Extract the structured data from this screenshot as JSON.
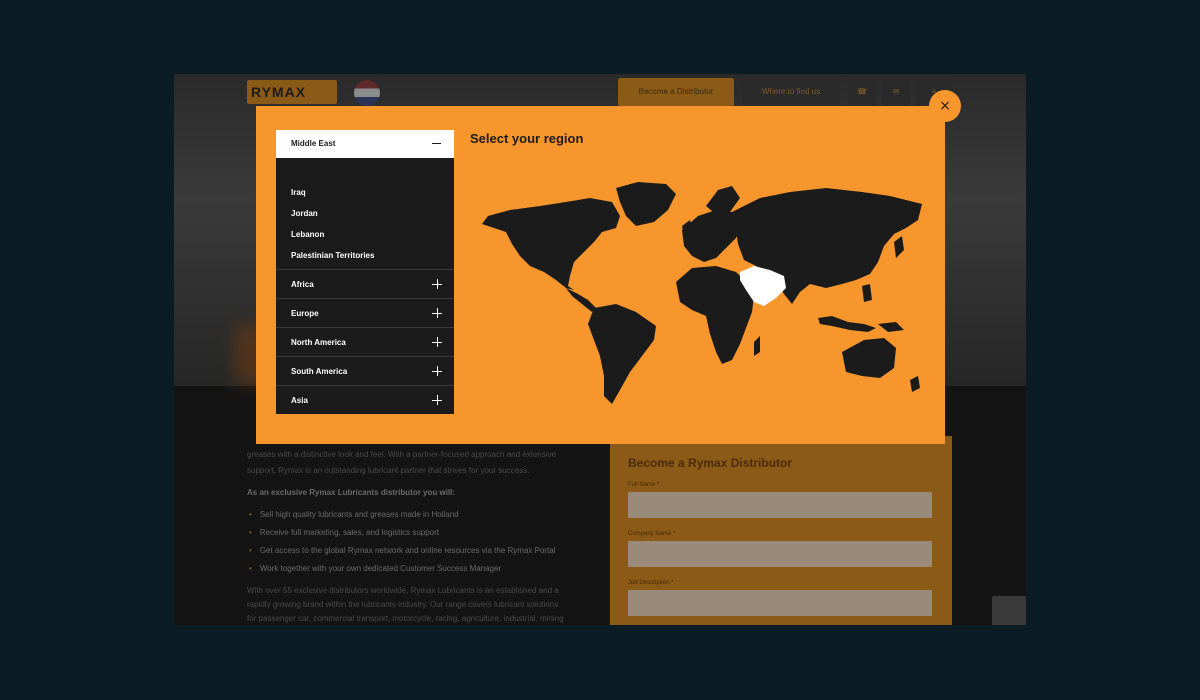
{
  "background_page": {
    "logo_text": "RYMAX",
    "header_buttons": {
      "distributor": "Become a Distributor",
      "find": "Where to find us"
    },
    "intro_lines": [
      "greases with a distinctive look and feel. With a partner-focused approach and extensive",
      "support, Rymax is an outstanding lubricant partner that strives for your success."
    ],
    "benefits_heading": "As an exclusive Rymax Lubricants distributor you will:",
    "benefits": [
      "Sell high quality lubricants and greases made in Holland",
      "Receive full marketing, sales, and logistics support",
      "Get access to the global Rymax network and online resources via the Rymax Portal",
      "Work together with your own dedicated Customer Success Manager"
    ],
    "closing_lines": [
      "With over 55 exclusive distributors worldwide, Rymax Lubricants is an established and a",
      "rapidly growing brand within the lubricants industry. Our range covers lubricant solutions",
      "for passenger car, commercial transport, motorcycle, racing, agriculture, industrial, mining"
    ],
    "form": {
      "title": "Become a Rymax Distributor",
      "fields": [
        "Full Name *",
        "Company Name *",
        "Job Description *"
      ]
    }
  },
  "modal": {
    "title": "Select your region",
    "active_region": {
      "label": "Middle East",
      "countries": [
        "Iraq",
        "Jordan",
        "Lebanon",
        "Palestinian Territories"
      ]
    },
    "regions": [
      "Africa",
      "Europe",
      "North America",
      "South America",
      "Asia"
    ],
    "close_label": "×",
    "highlighted_region": "Middle East",
    "colors": {
      "modal_bg": "#f7962c",
      "panel_bg": "#1b1b1b",
      "land": "#1b1b1b",
      "highlight": "#ffffff"
    }
  }
}
